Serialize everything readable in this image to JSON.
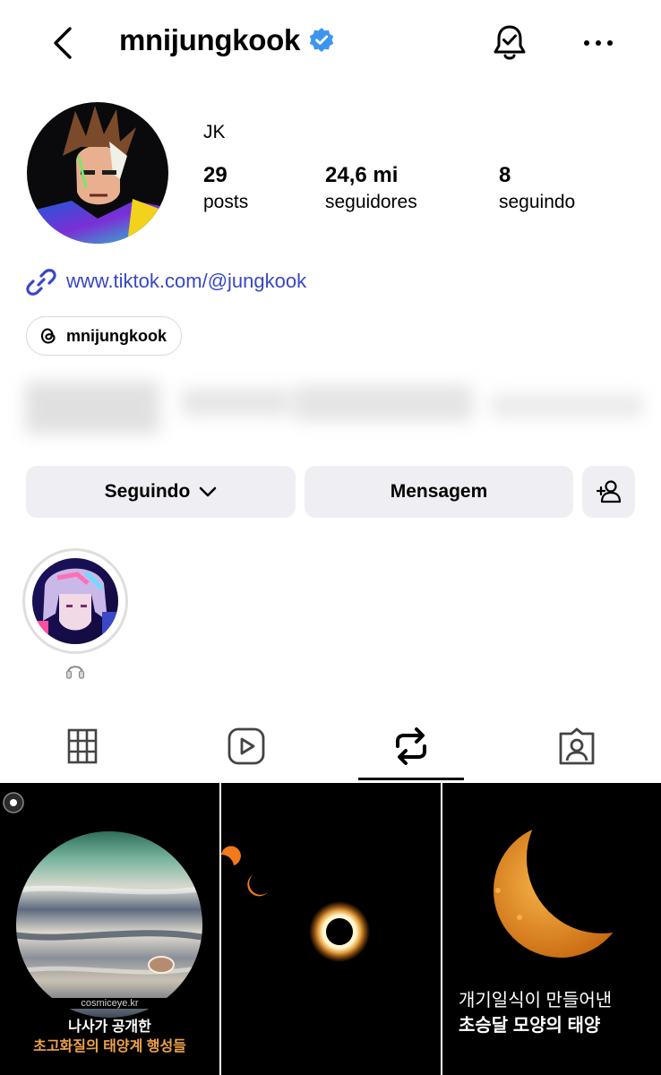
{
  "header": {
    "username": "mnijungkook",
    "icons": {
      "back": "chevron-left-icon",
      "verified": "verified-badge-icon",
      "notifications": "bell-check-icon",
      "more": "more-horizontal-icon"
    }
  },
  "profile": {
    "display_name": "JK",
    "stats": [
      {
        "value": "29",
        "label": "posts"
      },
      {
        "value": "24,6 mi",
        "label": "seguidores"
      },
      {
        "value": "8",
        "label": "seguindo"
      }
    ],
    "link": "www.tiktok.com/@jungkook",
    "threads_handle": "mnijungkook"
  },
  "actions": {
    "following": "Seguindo",
    "message": "Mensagem",
    "add_user_icon": "add-person-icon"
  },
  "highlight": {
    "icon": "headphones-icon"
  },
  "tabs": [
    {
      "name": "grid",
      "icon": "grid-icon"
    },
    {
      "name": "reels",
      "icon": "reels-icon"
    },
    {
      "name": "reposts",
      "icon": "repost-icon",
      "active": true
    },
    {
      "name": "tagged",
      "icon": "tagged-icon"
    }
  ],
  "posts": [
    {
      "watermark": "cosmiceye.kr",
      "caption_line1": "나사가 공개한",
      "caption_line2": "초고화질의 태양계 행성들"
    },
    {
      "caption_line1": "",
      "caption_line2": ""
    },
    {
      "caption_line1": "개기일식이 만들어낸",
      "caption_line2": "초승달 모양의 태양"
    }
  ],
  "colors": {
    "link": "#3847c5",
    "verified": "#3d95f0",
    "button_bg": "#efeff3",
    "caption_orange": "#f0a24a"
  }
}
